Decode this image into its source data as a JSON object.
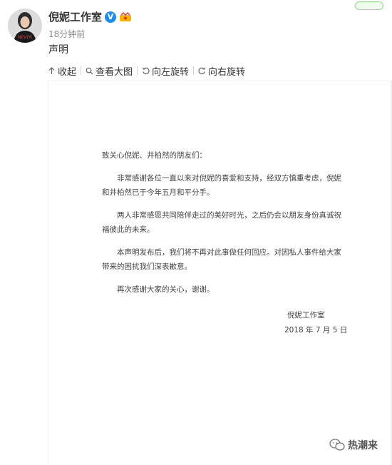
{
  "header": {
    "username": "倪妮工作室",
    "verified_badge": "V",
    "timestamp": "18分钟前",
    "statement": "声明",
    "avatar_text": "NEVER"
  },
  "toolbar": {
    "collect": {
      "label": "收起",
      "icon": "arrow-up-icon"
    },
    "view_large": {
      "label": "查看大图",
      "icon": "magnifier-icon"
    },
    "rotate_left": {
      "label": "向左旋转",
      "icon": "rotate-left-icon"
    },
    "rotate_right": {
      "label": "向右旋转",
      "icon": "rotate-right-icon"
    }
  },
  "document": {
    "salutation": "致关心倪妮、井柏然的朋友们：",
    "paragraphs": [
      "非常感谢各位一直以来对倪妮的喜爱和支持，经双方慎重考虑，倪妮和井柏然已于今年五月和平分手。",
      "两人非常感恩共同陪伴走过的美好时光，之后仍会以朋友身份真诚祝福彼此的未来。",
      "本声明发布后，我们将不再对此事做任何回应。对因私人事件给大家带来的困扰我们深表歉意。",
      "再次感谢大家的关心，谢谢。"
    ],
    "signature": "倪妮工作室",
    "date": "2018 年 7 月 5 日"
  },
  "watermark": {
    "text": "热潮来"
  },
  "colors": {
    "verified_blue": "#1d8cf0",
    "doc_bg": "#f0f0f0"
  }
}
